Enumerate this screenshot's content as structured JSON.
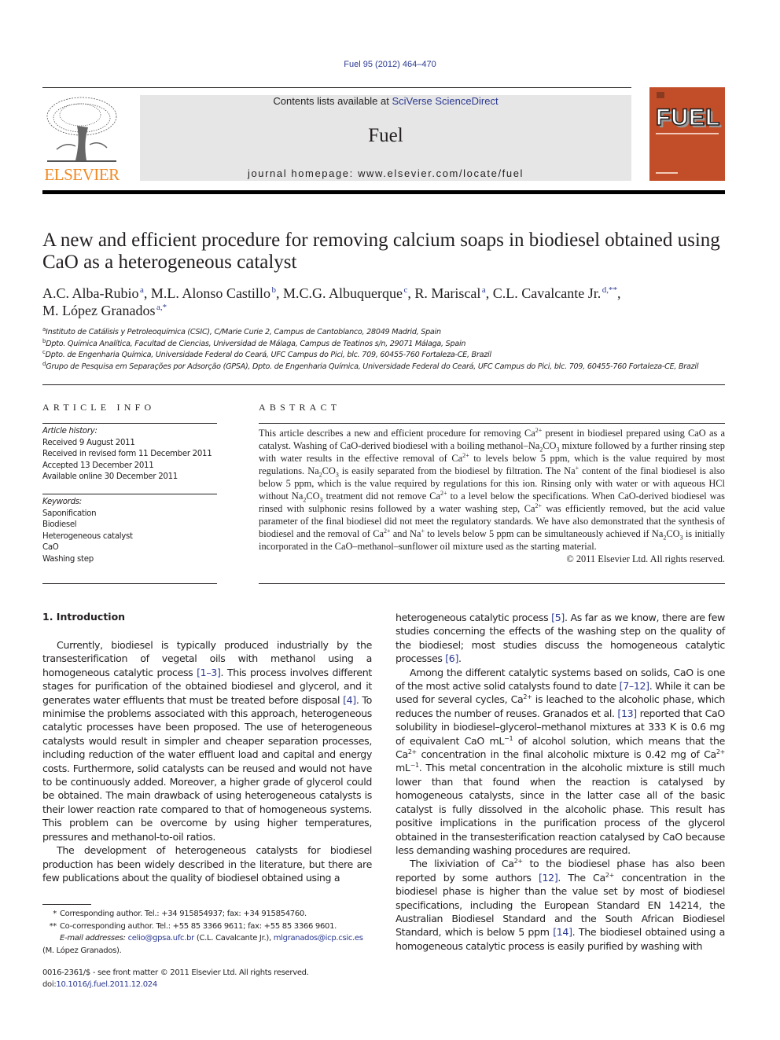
{
  "header": {
    "citation": "Fuel 95 (2012) 464–470",
    "contents_prefix": "Contents lists available at ",
    "contents_link": "SciVerse ScienceDirect",
    "journal_name": "Fuel",
    "homepage_label": "journal homepage: ",
    "homepage_url": "www.elsevier.com/locate/fuel",
    "publisher_logo_text": "ELSEVIER",
    "cover_title": "FUEL",
    "colors": {
      "publisher": "#f08a24",
      "link": "#2b3990",
      "cover": "#c24e29",
      "banner": "#e6e6e6"
    }
  },
  "article": {
    "title": "A new and efficient procedure for removing calcium soaps in biodiesel obtained using CaO as a heterogeneous catalyst",
    "authors": [
      {
        "name": "A.C. Alba-Rubio",
        "sup": "a"
      },
      {
        "name": "M.L. Alonso Castillo",
        "sup": "b"
      },
      {
        "name": "M.C.G. Albuquerque",
        "sup": "c"
      },
      {
        "name": "R. Mariscal",
        "sup": "a"
      },
      {
        "name": "C.L. Cavalcante Jr.",
        "sup": "d,**"
      },
      {
        "name": "M. López Granados",
        "sup": "a,*"
      }
    ],
    "affiliations": [
      {
        "key": "a",
        "text": "Instituto de Catálisis y Petroleoquímica (CSIC), C/Marie Curie 2, Campus de Cantoblanco, 28049 Madrid, Spain"
      },
      {
        "key": "b",
        "text": "Dpto. Química Analítica, Facultad de Ciencias, Universidad de Málaga, Campus de Teatinos s/n, 29071 Málaga, Spain"
      },
      {
        "key": "c",
        "text": "Dpto. de Engenharia Química, Universidade Federal do Ceará, UFC Campus do Pici, blc. 709, 60455-760 Fortaleza-CE, Brazil"
      },
      {
        "key": "d",
        "text": "Grupo de Pesquisa em Separações por Adsorção (GPSA), Dpto. de Engenharia Química, Universidade Federal do Ceará, UFC Campus do Pici, blc. 709, 60455-760 Fortaleza-CE, Brazil"
      }
    ]
  },
  "article_info": {
    "heading": "ARTICLE INFO",
    "history_label": "Article history:",
    "history": [
      "Received 9 August 2011",
      "Received in revised form 11 December 2011",
      "Accepted 13 December 2011",
      "Available online 30 December 2011"
    ],
    "keywords_label": "Keywords:",
    "keywords": [
      "Saponification",
      "Biodiesel",
      "Heterogeneous catalyst",
      "CaO",
      "Washing step"
    ]
  },
  "abstract": {
    "heading": "ABSTRACT",
    "copyright": "© 2011 Elsevier Ltd. All rights reserved."
  },
  "intro": {
    "heading": "1. Introduction"
  },
  "footnotes": {
    "corr1_mark": "*",
    "corr1": "Corresponding author. Tel.: +34 915854937; fax: +34 915854760.",
    "corr2_mark": "**",
    "corr2": "Co-corresponding author. Tel.: +55 85 3366 9611; fax: +55 85 3366 9601.",
    "email_label": "E-mail addresses:",
    "email1": "celio@gpsa.ufc.br",
    "email1_name": " (C.L. Cavalcante Jr.), ",
    "email2": "mlgranados@icp.csic.es",
    "email2_name": "(M. López Granados).",
    "issn": "0016-2361/$ - see front matter © 2011 Elsevier Ltd. All rights reserved.",
    "doi_label": "doi:",
    "doi": "10.1016/j.fuel.2011.12.024"
  }
}
